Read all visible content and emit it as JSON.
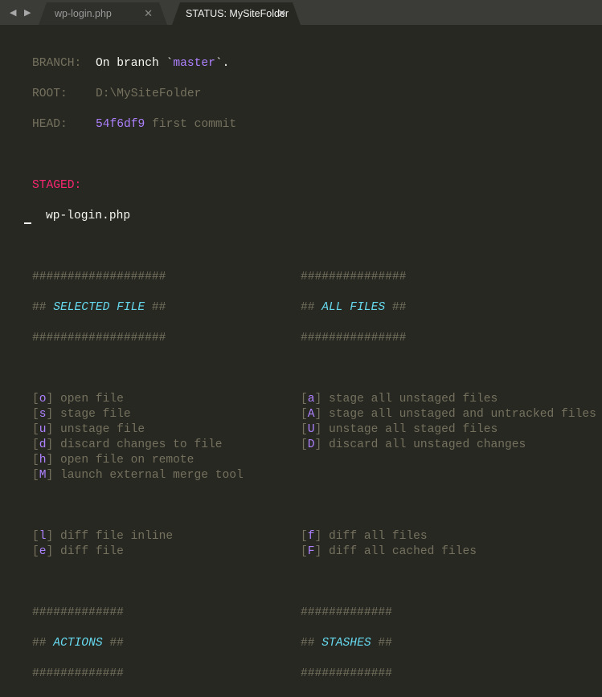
{
  "tabs": [
    {
      "label": "wp-login.php",
      "close": "✕"
    },
    {
      "label": "STATUS: MySiteFolder",
      "close": "✕"
    }
  ],
  "nav": "◀ ▶",
  "status": {
    "branch_label": "BRANCH:",
    "branch_pre": "On branch `",
    "branch_name": "master",
    "branch_post": "`.",
    "root_label": "ROOT:",
    "root": "D:\\MySiteFolder",
    "head_label": "HEAD:",
    "head_hash": "54f6df9",
    "head_msg": "first commit",
    "staged_label": "STAGED:",
    "staged_files": [
      "wp-login.php"
    ]
  },
  "sections": {
    "selected": {
      "rule": "###################",
      "title": "SELECTED FILE"
    },
    "all": {
      "rule": "###############",
      "title": "ALL FILES"
    },
    "actions": {
      "rule": "#############",
      "title": "ACTIONS"
    },
    "stashes": {
      "rule": "#############",
      "title": "STASHES"
    }
  },
  "selected_cmds": [
    {
      "key": "o",
      "label": "open file"
    },
    {
      "key": "s",
      "label": "stage file"
    },
    {
      "key": "u",
      "label": "unstage file"
    },
    {
      "key": "d",
      "label": "discard changes to file"
    },
    {
      "key": "h",
      "label": "open file on remote"
    },
    {
      "key": "M",
      "label": "launch external merge tool"
    }
  ],
  "all_cmds": [
    {
      "key": "a",
      "label": "stage all unstaged files"
    },
    {
      "key": "A",
      "label": "stage all unstaged and untracked files"
    },
    {
      "key": "U",
      "label": "unstage all staged files"
    },
    {
      "key": "D",
      "label": "discard all unstaged changes"
    }
  ],
  "diff_left": [
    {
      "key": "l",
      "label": "diff file inline"
    },
    {
      "key": "e",
      "label": "diff file"
    }
  ],
  "diff_right": [
    {
      "key": "f",
      "label": "diff all files"
    },
    {
      "key": "F",
      "label": "diff all cached files"
    }
  ]
}
